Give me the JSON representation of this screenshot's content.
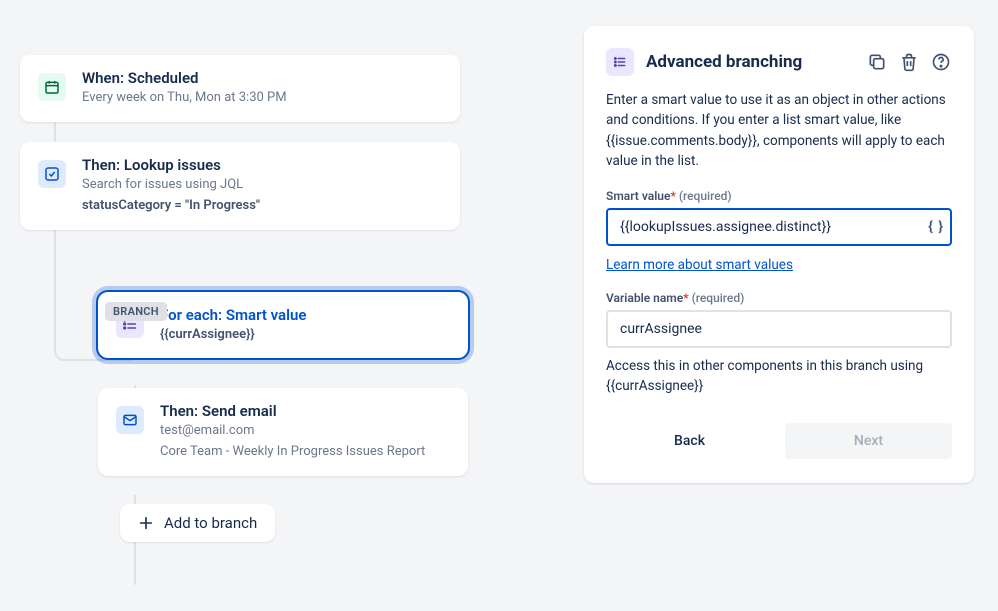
{
  "flow": {
    "step1": {
      "title": "When: Scheduled",
      "sub": "Every week on Thu, Mon at 3:30 PM"
    },
    "step2": {
      "title": "Then: Lookup issues",
      "sub1": "Search for issues using JQL",
      "sub2": "statusCategory = \"In Progress\""
    },
    "branch_label": "BRANCH",
    "step3": {
      "title": "For each: Smart value",
      "sub": "{{currAssignee}}"
    },
    "step4": {
      "title": "Then: Send email",
      "sub1": "test@email.com",
      "sub2": "Core Team - Weekly In Progress Issues Report"
    },
    "add_branch": "Add to branch"
  },
  "panel": {
    "title": "Advanced branching",
    "description": "Enter a smart value to use it as an object in other actions and conditions. If you enter a list smart value, like {{issue.comments.body}}, components will apply to each value in the list.",
    "field1_label": "Smart value",
    "required_marker": "*",
    "required_text": "(required)",
    "field1_value": "{{lookupIssues.assignee.distinct}}",
    "field1_suffix": "{ }",
    "learn_more": "Learn more about smart values",
    "field2_label": "Variable name",
    "field2_value": "currAssignee",
    "hint": "Access this in other components in this branch using {{currAssignee}}",
    "back": "Back",
    "next": "Next"
  }
}
